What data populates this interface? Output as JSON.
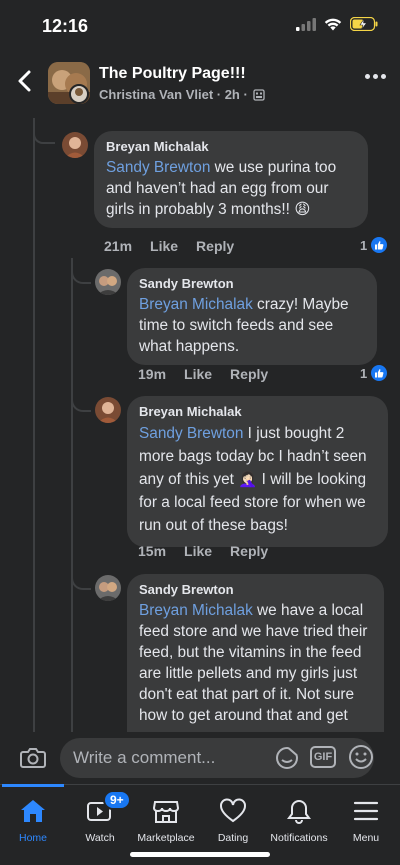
{
  "status_bar": {
    "time": "12:16"
  },
  "header": {
    "title": "The Poultry Page!!!",
    "subtitle": "Christina Van Vliet · 2h ·"
  },
  "comments": [
    {
      "author": "Breyan Michalak",
      "mention": "Sandy Brewton",
      "text": " we use purina too and haven’t had an egg from our girls in probably 3 months!! 😩",
      "time": "21m",
      "like_label": "Like",
      "reply_label": "Reply",
      "reactions": "1"
    },
    {
      "author": "Sandy Brewton",
      "mention": "Breyan Michalak",
      "text": " crazy! Maybe time to switch feeds and see what happens.",
      "time": "19m",
      "like_label": "Like",
      "reply_label": "Reply",
      "reactions": "1"
    },
    {
      "author": "Breyan Michalak",
      "mention": "Sandy Brewton",
      "text": " I just bought 2 more bags today bc I hadn’t seen any of this yet 🤦🏻‍♀️ I will be looking for a local feed store for when we run out of these bags!",
      "time": "15m",
      "like_label": "Like",
      "reply_label": "Reply"
    },
    {
      "author": "Sandy Brewton",
      "mention": "Breyan Michalak",
      "text": " we have a local feed store and we have tried their feed, but the vitamins in the feed are little pellets and my girls just don't eat that part of it. Not sure how to get around that and get"
    }
  ],
  "composer": {
    "placeholder": "Write a comment...",
    "gif_label": "GIF"
  },
  "tabs": [
    {
      "label": "Home",
      "icon": "home-icon",
      "active": true
    },
    {
      "label": "Watch",
      "icon": "watch-icon",
      "badge": "9+"
    },
    {
      "label": "Marketplace",
      "icon": "marketplace-icon"
    },
    {
      "label": "Dating",
      "icon": "dating-icon"
    },
    {
      "label": "Notifications",
      "icon": "bell-icon"
    },
    {
      "label": "Menu",
      "icon": "menu-icon"
    }
  ],
  "colors": {
    "background": "#242526",
    "bubble": "#3a3b3c",
    "mention": "#6fa0e0",
    "accent": "#2d88ff"
  }
}
